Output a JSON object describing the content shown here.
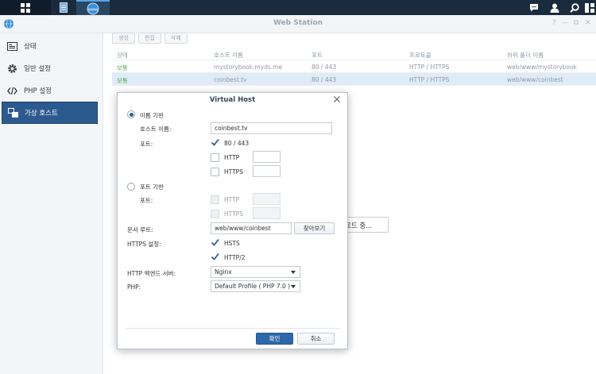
{
  "taskbar": {
    "icons": [
      "main-menu-icon",
      "file-doc-icon",
      "web-station-icon",
      "chat-icon",
      "user-icon",
      "search-icon",
      "widgets-icon"
    ],
    "www_label": "www"
  },
  "window": {
    "title": "Web Station",
    "controls": [
      "?",
      "—",
      "⧉",
      "✕"
    ]
  },
  "sidebar": {
    "items": [
      {
        "label": "상태",
        "icon": "status-icon"
      },
      {
        "label": "일반 설정",
        "icon": "gear-icon"
      },
      {
        "label": "PHP 설정",
        "icon": "code-icon"
      },
      {
        "label": "가상 호스트",
        "icon": "virtual-host-icon"
      }
    ],
    "active_index": 3
  },
  "toolbar": {
    "create_label": "생성",
    "edit_label": "편집",
    "delete_label": "삭제"
  },
  "table": {
    "headers": [
      "상태",
      "호스트 이름",
      "포트",
      "프로토콜",
      "하위 폴더 이름"
    ],
    "rows": [
      [
        "보통",
        "mystorybook.myds.me",
        "80 / 443",
        "HTTP / HTTPS",
        "web/www/mystorybook"
      ],
      [
        "보통",
        "coinbest.tv",
        "80 / 443",
        "HTTP / HTTPS",
        "web/www/coinbest"
      ]
    ]
  },
  "loading_text": "로드 중...",
  "dialog": {
    "title": "Virtual Host",
    "name_based_label": "이름 기반",
    "hostname_label": "호스트 이름:",
    "hostname_value": "coinbest.tv",
    "port_label": "포트:",
    "port_default_label": "80 / 443",
    "http_label": "HTTP",
    "https_label": "HTTPS",
    "port_based_label": "포트 기반",
    "port_label2": "포트:",
    "http_label2": "HTTP",
    "https_label2": "HTTPS",
    "doc_root_label": "문서 루트:",
    "doc_root_value": "web/www/coinbest",
    "browse_label": "찾아보기",
    "https_settings_label": "HTTPS 설정:",
    "hsts_label": "HSTS",
    "http2_label": "HTTP/2",
    "backend_label": "HTTP 백엔드 서버:",
    "backend_value": "Nginx",
    "php_label": "PHP:",
    "php_value": "Default Profile ( PHP 7.0 )",
    "ok_label": "확인",
    "cancel_label": "취소"
  },
  "colors": {
    "taskbar": "#1a2b3e",
    "active_item": "#2c5a8f",
    "status_green": "#57ad4b",
    "primary_button": "#2f67a7"
  }
}
